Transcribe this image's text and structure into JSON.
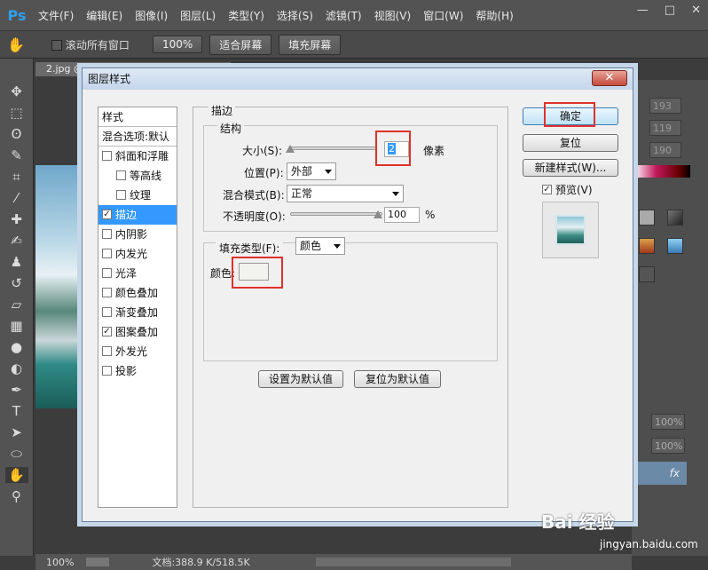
{
  "app": {
    "logo": "Ps",
    "menu": [
      "文件(F)",
      "编辑(E)",
      "图像(I)",
      "图层(L)",
      "类型(Y)",
      "选择(S)",
      "滤镜(T)",
      "视图(V)",
      "窗口(W)",
      "帮助(H)"
    ],
    "window_controls": [
      "—",
      "□",
      "✕"
    ]
  },
  "options_bar": {
    "scroll_all_label": "滚动所有窗口",
    "zoom_value": "100%",
    "fit_screen_label": "适合屏幕",
    "fill_screen_label": "填充屏幕"
  },
  "document": {
    "tab_label": "2.jpg @ 100% (背景副本, RGB/8#) *",
    "status_zoom": "100%",
    "status_doc": "文档:388.9 K/518.5K"
  },
  "right_panel": {
    "values": [
      "193",
      "119",
      "190"
    ],
    "opacity_values": [
      "100%",
      "100%"
    ],
    "fx_label": "fx"
  },
  "dialog": {
    "title": "图层样式",
    "close_label": "✕",
    "style_list": {
      "header": "样式",
      "blend_options": "混合选项:默认",
      "items": [
        {
          "label": "斜面和浮雕",
          "checked": false,
          "sub": false
        },
        {
          "label": "等高线",
          "checked": false,
          "sub": true
        },
        {
          "label": "纹理",
          "checked": false,
          "sub": true
        },
        {
          "label": "描边",
          "checked": true,
          "sub": false,
          "selected": true
        },
        {
          "label": "内阴影",
          "checked": false,
          "sub": false
        },
        {
          "label": "内发光",
          "checked": false,
          "sub": false
        },
        {
          "label": "光泽",
          "checked": false,
          "sub": false
        },
        {
          "label": "颜色叠加",
          "checked": false,
          "sub": false
        },
        {
          "label": "渐变叠加",
          "checked": false,
          "sub": false
        },
        {
          "label": "图案叠加",
          "checked": true,
          "sub": false
        },
        {
          "label": "外发光",
          "checked": false,
          "sub": false
        },
        {
          "label": "投影",
          "checked": false,
          "sub": false
        }
      ]
    },
    "stroke": {
      "group_title": "描边",
      "structure_title": "结构",
      "size_label": "大小(S):",
      "size_value": "2",
      "size_unit": "像素",
      "position_label": "位置(P):",
      "position_value": "外部",
      "blend_mode_label": "混合模式(B):",
      "blend_mode_value": "正常",
      "opacity_label": "不透明度(O):",
      "opacity_value": "100",
      "opacity_unit": "%",
      "fill_type_label": "填充类型(F):",
      "fill_type_value": "颜色",
      "color_label": "颜色:",
      "color_value": "#f2f2ee"
    },
    "buttons": {
      "ok": "确定",
      "reset": "复位",
      "new_style": "新建样式(W)...",
      "preview": "预览(V)",
      "make_default": "设置为默认值",
      "reset_default": "复位为默认值"
    }
  },
  "watermark": {
    "text": "Bai 经验",
    "url": "jingyan.baidu.com"
  }
}
